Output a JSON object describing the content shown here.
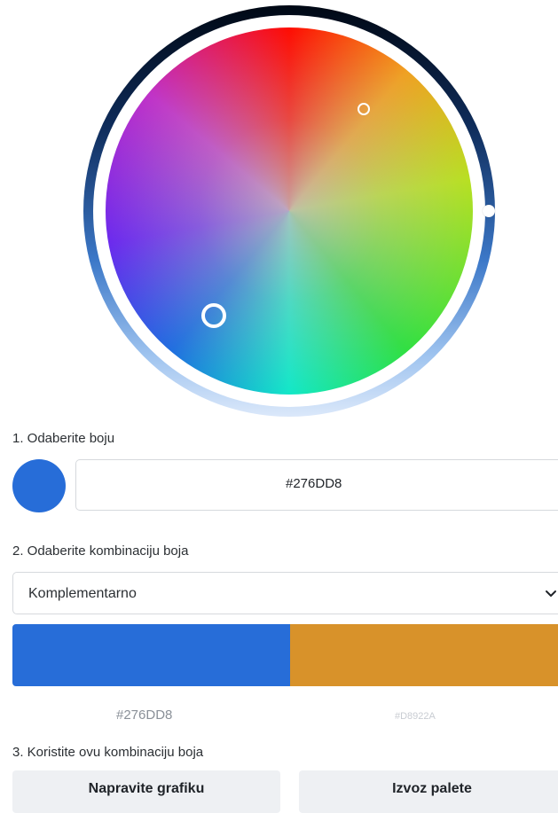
{
  "selected_color": "#276DD8",
  "complementary_color": "#D8922A",
  "step1": {
    "label": "1. Odaberite boju",
    "hex_value": "#276DD8"
  },
  "step2": {
    "label": "2. Odaberite kombinaciju boja",
    "combination_selected": "Komplementarno"
  },
  "palette": {
    "colors": [
      {
        "hex": "#276DD8",
        "label": "#276DD8"
      },
      {
        "hex": "#D8922A",
        "label": "#D8922A"
      }
    ]
  },
  "step3": {
    "label": "3. Koristite ovu kombinaciju boja",
    "create_button": "Napravite grafiku",
    "export_button": "Izvoz palete"
  },
  "icons": {
    "select_chevron": "chevron-down-icon"
  }
}
